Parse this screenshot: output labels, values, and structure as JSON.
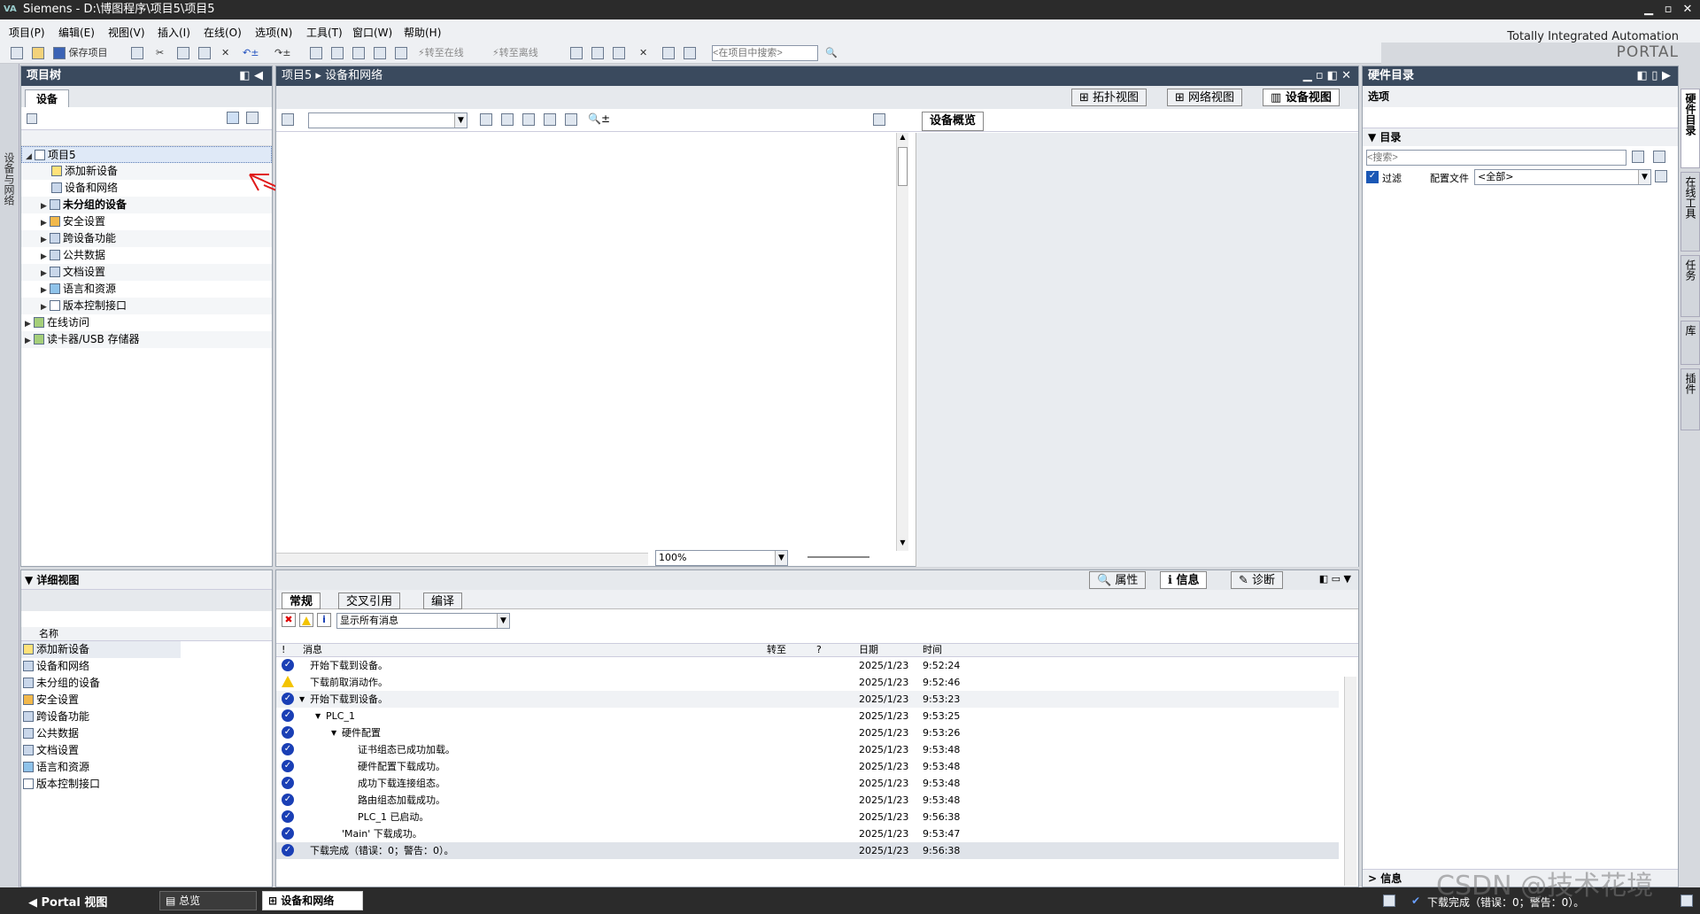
{
  "window": {
    "title": "Siemens  -  D:\\博图程序\\项目5\\项目5",
    "logo": "VA"
  },
  "menu": [
    "项目(P)",
    "编辑(E)",
    "视图(V)",
    "插入(I)",
    "在线(O)",
    "选项(N)",
    "工具(T)",
    "窗口(W)",
    "帮助(H)"
  ],
  "brand": {
    "line1": "Totally Integrated Automation",
    "line2": "PORTAL"
  },
  "toolbar": {
    "save": "保存项目",
    "go_online": "转至在线",
    "go_offline": "转至离线",
    "search_placeholder": "<在项目中搜索>"
  },
  "sidetab": "设备与网络",
  "project_tree": {
    "title": "项目树",
    "tab": "设备",
    "items": [
      {
        "label": "项目5",
        "indent": 0,
        "expanded": true
      },
      {
        "label": "添加新设备",
        "indent": 1
      },
      {
        "label": "设备和网络",
        "indent": 1
      },
      {
        "label": "未分组的设备",
        "indent": 1,
        "bold": true,
        "collapsed": true
      },
      {
        "label": "安全设置",
        "indent": 1,
        "collapsed": true
      },
      {
        "label": "跨设备功能",
        "indent": 1,
        "collapsed": true
      },
      {
        "label": "公共数据",
        "indent": 1,
        "collapsed": true
      },
      {
        "label": "文档设置",
        "indent": 1,
        "collapsed": true
      },
      {
        "label": "语言和资源",
        "indent": 1,
        "collapsed": true
      },
      {
        "label": "版本控制接口",
        "indent": 1,
        "collapsed": true
      },
      {
        "label": "在线访问",
        "indent": 0,
        "collapsed": true
      },
      {
        "label": "读卡器/USB 存储器",
        "indent": 0,
        "collapsed": true
      }
    ]
  },
  "center": {
    "breadcrumb": [
      "项目5",
      "设备和网络"
    ],
    "views": [
      "拓扑视图",
      "网络视图",
      "设备视图"
    ],
    "device_overview": "设备概览",
    "zoom": "100%"
  },
  "detail_view": {
    "title": "详细视图",
    "column": "名称",
    "items": [
      "添加新设备",
      "设备和网络",
      "未分组的设备",
      "安全设置",
      "跨设备功能",
      "公共数据",
      "文档设置",
      "语言和资源",
      "版本控制接口"
    ]
  },
  "info_panel": {
    "top_tabs": [
      "属性",
      "信息",
      "诊断"
    ],
    "tabs": [
      "常规",
      "交叉引用",
      "编译"
    ],
    "filter": "显示所有消息",
    "columns": {
      "icon": "!",
      "message": "消息",
      "goto": "转至",
      "q": "?",
      "date": "日期",
      "time": "时间"
    },
    "rows": [
      {
        "type": "ok",
        "indent": 0,
        "text": "开始下载到设备。",
        "date": "2025/1/23",
        "time": "9:52:24"
      },
      {
        "type": "warn",
        "indent": 0,
        "text": "下载前取消动作。",
        "date": "2025/1/23",
        "time": "9:52:46"
      },
      {
        "type": "ok",
        "indent": 0,
        "text": "开始下载到设备。",
        "date": "2025/1/23",
        "time": "9:53:23",
        "exp": true
      },
      {
        "type": "ok",
        "indent": 1,
        "text": "PLC_1",
        "date": "2025/1/23",
        "time": "9:53:25",
        "exp": true
      },
      {
        "type": "ok",
        "indent": 2,
        "text": "硬件配置",
        "date": "2025/1/23",
        "time": "9:53:26",
        "exp": true
      },
      {
        "type": "ok",
        "indent": 3,
        "text": "证书组态已成功加载。",
        "date": "2025/1/23",
        "time": "9:53:48"
      },
      {
        "type": "ok",
        "indent": 3,
        "text": "硬件配置下载成功。",
        "date": "2025/1/23",
        "time": "9:53:48"
      },
      {
        "type": "ok",
        "indent": 3,
        "text": "成功下载连接组态。",
        "date": "2025/1/23",
        "time": "9:53:48"
      },
      {
        "type": "ok",
        "indent": 3,
        "text": "路由组态加载成功。",
        "date": "2025/1/23",
        "time": "9:53:48"
      },
      {
        "type": "ok",
        "indent": 3,
        "text": "PLC_1 已启动。",
        "date": "2025/1/23",
        "time": "9:56:38"
      },
      {
        "type": "ok",
        "indent": 2,
        "text": "'Main' 下载成功。",
        "date": "2025/1/23",
        "time": "9:53:47"
      },
      {
        "type": "ok",
        "indent": 0,
        "text": "下载完成（错误：0；警告：0）。",
        "date": "2025/1/23",
        "time": "9:56:38"
      }
    ]
  },
  "hw_catalog": {
    "title": "硬件目录",
    "options": "选项",
    "catalog": "目录",
    "search_placeholder": "<搜索>",
    "filter": "过滤",
    "profile_label": "配置文件",
    "profile_value": "<全部>",
    "info": "信息"
  },
  "right_vtabs": [
    "硬件目录",
    "在线工具",
    "任务",
    "库",
    "插件"
  ],
  "statusbar": {
    "portal": "Portal 视图",
    "tabs": [
      "总览",
      "设备和网络"
    ],
    "message": "下载完成（错误：0；警告：0）。"
  },
  "watermark": "CSDN @技术花境"
}
